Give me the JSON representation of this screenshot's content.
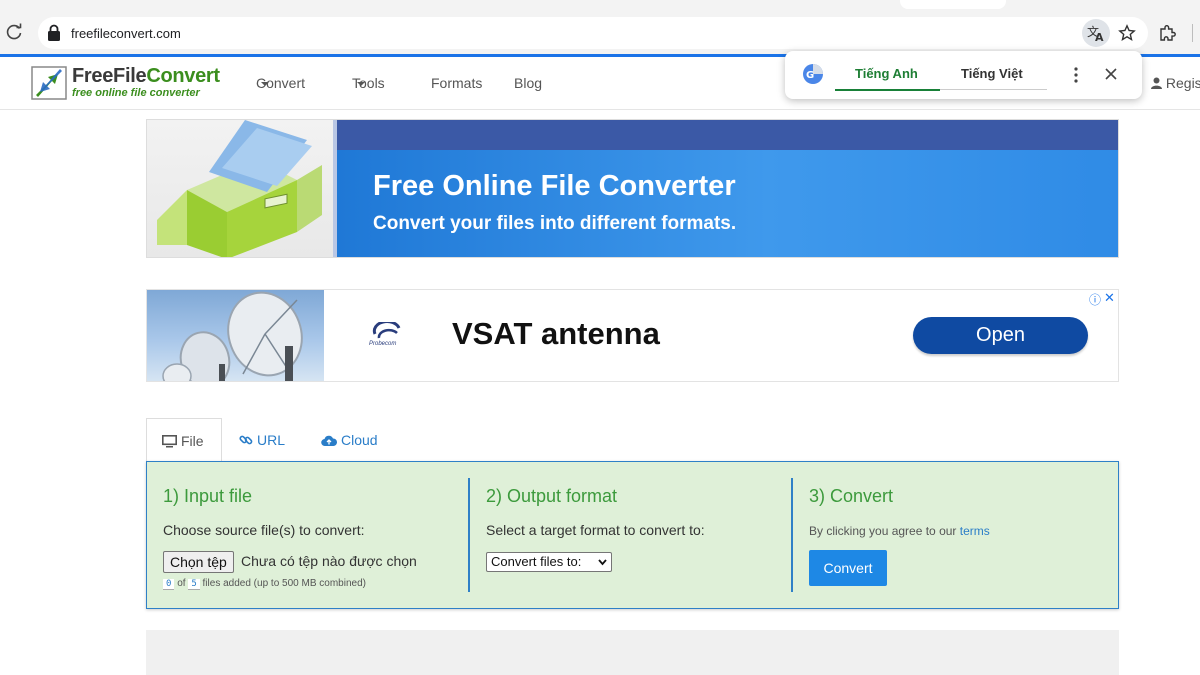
{
  "browser": {
    "url": "freefileconvert.com"
  },
  "site": {
    "logo_title_a": "FreeFile",
    "logo_title_b": "Convert",
    "logo_subtitle": "free online file converter",
    "nav": {
      "convert": "Convert",
      "tools": "Tools",
      "formats": "Formats",
      "blog": "Blog"
    },
    "register": "Regis"
  },
  "translate_popup": {
    "source_lang": "Tiếng Anh",
    "target_lang": "Tiếng Việt"
  },
  "hero": {
    "title": "Free Online File Converter",
    "subtitle": "Convert your files into different formats."
  },
  "ad": {
    "brand": "Probecom",
    "title": "VSAT antenna",
    "cta": "Open",
    "info_glyph": "ⓘ",
    "close_glyph": "✕"
  },
  "tabs": {
    "file": "File",
    "url": "URL",
    "cloud": "Cloud"
  },
  "converter": {
    "step1": {
      "title": "1) Input file",
      "instruction": "Choose source file(s) to convert:",
      "choose_button": "Chọn tệp",
      "file_status": "Chưa có tệp nào được chọn",
      "files_added": "0",
      "files_of_label": "of",
      "files_max": "5",
      "files_note": "files added (up to 500 MB combined)"
    },
    "step2": {
      "title": "2) Output format",
      "instruction": "Select a target format to convert to:",
      "select_value": "Convert files to:"
    },
    "step3": {
      "title": "3) Convert",
      "agree_prefix": "By clicking you agree to our",
      "terms_link": "terms",
      "button": "Convert"
    }
  }
}
